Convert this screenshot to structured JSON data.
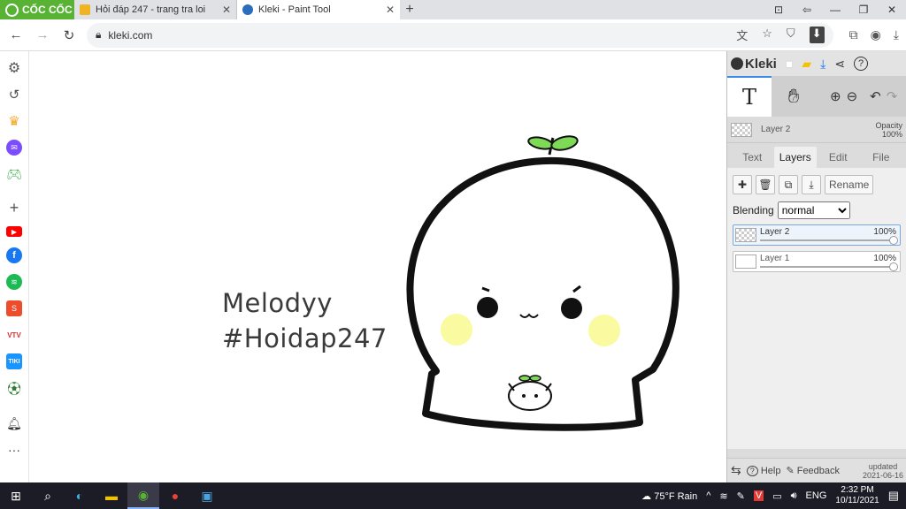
{
  "browser": {
    "brand": "CỐC CỐC",
    "tabs": [
      {
        "title": "Hỏi đáp 247 - trang tra loi",
        "favicon_color": "#f0b323",
        "active": false
      },
      {
        "title": "Kleki - Paint Tool",
        "favicon_color": "#2a6ebb",
        "active": true
      }
    ],
    "new_tab_icon": "plus-icon",
    "url": "kleki.com"
  },
  "sidebar": {
    "items": [
      {
        "name": "settings",
        "icon": "gear-icon",
        "color": "#555555"
      },
      {
        "name": "history",
        "icon": "history-icon",
        "color": "#555555"
      },
      {
        "name": "crown",
        "icon": "crown-icon",
        "color": "#f5a623"
      },
      {
        "name": "messenger",
        "icon": "messenger-icon",
        "color": "#7b4dff"
      },
      {
        "name": "games",
        "icon": "gamepad-icon",
        "color": "#3fae49"
      },
      {
        "name": "add",
        "icon": "plus-icon",
        "color": "#555555"
      },
      {
        "name": "youtube",
        "icon": "youtube-icon",
        "color": "#ff0000"
      },
      {
        "name": "facebook",
        "icon": "facebook-icon",
        "color": "#1877f2"
      },
      {
        "name": "spotify",
        "icon": "spotify-icon",
        "color": "#1db954"
      },
      {
        "name": "shopee",
        "icon": "shopee-icon",
        "color": "#ee4d2d"
      },
      {
        "name": "vtv",
        "icon": "vtv-icon",
        "color": "#d32f2f"
      },
      {
        "name": "tiki",
        "icon": "tiki-icon",
        "color": "#1a94ff"
      },
      {
        "name": "football",
        "icon": "football-icon",
        "color": "#2e7d32"
      },
      {
        "name": "notifications",
        "icon": "bell-icon",
        "color": "#333333"
      },
      {
        "name": "more",
        "icon": "more-icon",
        "color": "#333333"
      }
    ]
  },
  "canvas": {
    "line1": "Melodyy",
    "line2": "#Hoidap247"
  },
  "kleki": {
    "logo": "Kleki",
    "current_layer": "Layer 2",
    "opacity_label": "Opacity",
    "opacity_value": "100%",
    "tabs": [
      "Text",
      "Layers",
      "Edit",
      "File"
    ],
    "active_tab": "Layers",
    "rename": "Rename",
    "blending_label": "Blending",
    "blending_value": "normal",
    "layers": [
      {
        "name": "Layer 2",
        "opacity": "100%",
        "active": true
      },
      {
        "name": "Layer 1",
        "opacity": "100%",
        "active": false
      }
    ],
    "footer": {
      "help": "Help",
      "feedback": "Feedback",
      "updated_label": "updated",
      "updated_date": "2021-06-16"
    }
  },
  "taskbar": {
    "weather": "75°F  Rain",
    "lang": "ENG",
    "time": "2:32 PM",
    "date": "10/11/2021"
  }
}
